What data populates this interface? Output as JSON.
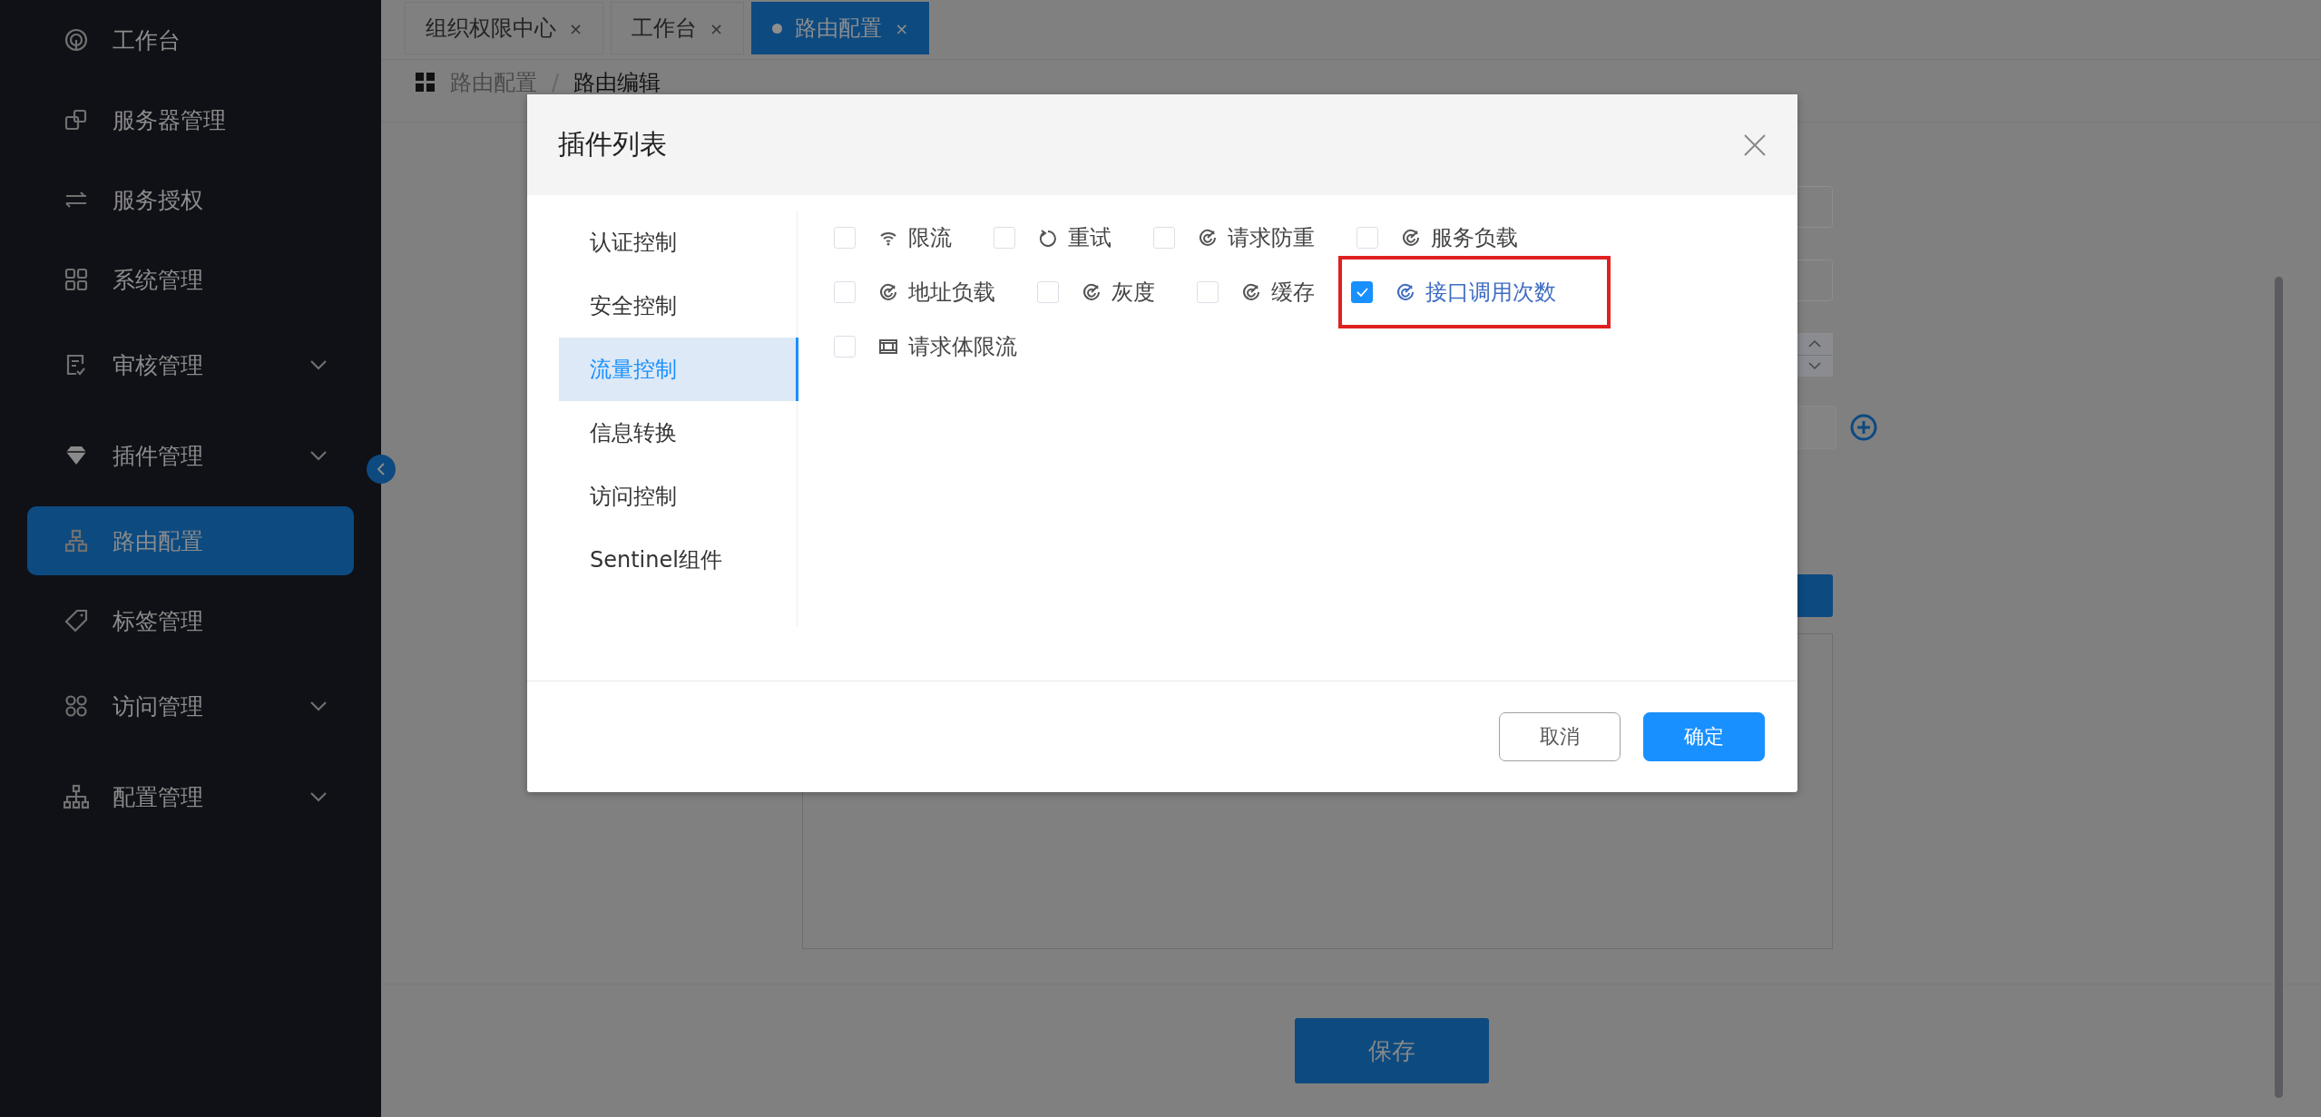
{
  "sidebar": {
    "items": [
      {
        "label": "工作台",
        "kind": "workbench",
        "selected": false
      },
      {
        "label": "服务器管理",
        "kind": "servers",
        "selected": false
      },
      {
        "label": "服务授权",
        "kind": "auth",
        "selected": false
      },
      {
        "label": "系统管理",
        "kind": "system",
        "selected": false
      },
      {
        "label": "审核管理",
        "kind": "audit",
        "selected": false,
        "expanded": false
      },
      {
        "label": "插件管理",
        "kind": "plugin",
        "selected": false,
        "expanded": false
      },
      {
        "label": "路由配置",
        "kind": "route",
        "selected": true
      },
      {
        "label": "标签管理",
        "kind": "tag",
        "selected": false
      },
      {
        "label": "访问管理",
        "kind": "access",
        "selected": false,
        "expanded": false
      },
      {
        "label": "配置管理",
        "kind": "config",
        "selected": false,
        "expanded": false
      }
    ]
  },
  "tabs": [
    {
      "label": "组织权限中心",
      "close": "×",
      "selected": false
    },
    {
      "label": "工作台",
      "close": "×",
      "selected": false
    },
    {
      "label": "路由配置",
      "close": "×",
      "selected": true
    }
  ],
  "breadcrumb": {
    "items": [
      "路由配置",
      "路由编辑"
    ],
    "separator": "/"
  },
  "modal": {
    "title": "插件列表",
    "categories": [
      {
        "label": "认证控制",
        "selected": false
      },
      {
        "label": "安全控制",
        "selected": false
      },
      {
        "label": "流量控制",
        "selected": true
      },
      {
        "label": "信息转换",
        "selected": false
      },
      {
        "label": "访问控制",
        "selected": false
      },
      {
        "label": "Sentinel组件",
        "selected": false
      }
    ],
    "plugins": [
      {
        "label": "限流",
        "kind": "signal",
        "checked": false,
        "highlighted": false
      },
      {
        "label": "重试",
        "kind": "retry",
        "checked": false,
        "highlighted": false
      },
      {
        "label": "请求防重",
        "kind": "target",
        "checked": false,
        "highlighted": false
      },
      {
        "label": "服务负载",
        "kind": "target",
        "checked": false,
        "highlighted": false
      },
      {
        "label": "地址负载",
        "kind": "target",
        "checked": false,
        "highlighted": false
      },
      {
        "label": "灰度",
        "kind": "target",
        "checked": false,
        "highlighted": false
      },
      {
        "label": "缓存",
        "kind": "target",
        "checked": false,
        "highlighted": false
      },
      {
        "label": "接口调用次数",
        "kind": "target",
        "checked": true,
        "highlighted": true
      },
      {
        "label": "请求体限流",
        "kind": "film",
        "checked": false,
        "highlighted": false
      }
    ],
    "buttons": [
      {
        "label": "取消",
        "kind": "default"
      },
      {
        "label": "确定",
        "kind": "primary"
      }
    ]
  },
  "footer": {
    "save_button": "保存"
  }
}
